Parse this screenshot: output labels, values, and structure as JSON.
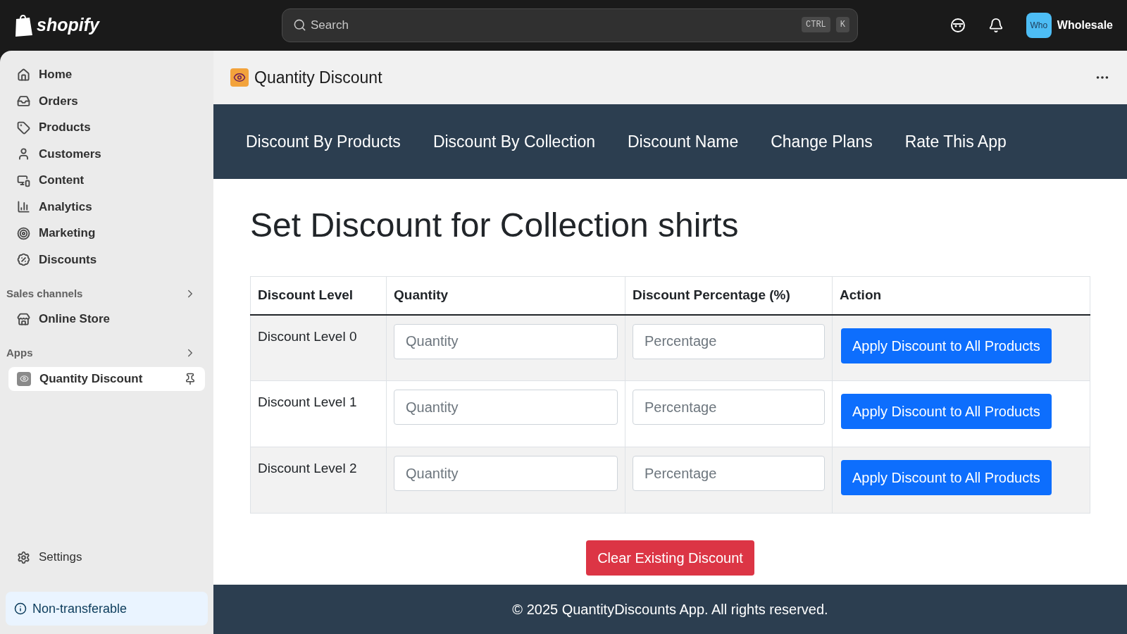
{
  "topbar": {
    "brand": "shopify",
    "search": {
      "placeholder": "Search",
      "shortcut": [
        "CTRL",
        "K"
      ]
    },
    "avatar": "Who",
    "store_name": "Wholesale"
  },
  "sidebar": {
    "items": [
      {
        "label": "Home",
        "selected": false
      },
      {
        "label": "Orders",
        "selected": false
      },
      {
        "label": "Products",
        "selected": false
      },
      {
        "label": "Customers",
        "selected": false
      },
      {
        "label": "Content",
        "selected": false
      },
      {
        "label": "Analytics",
        "selected": false
      },
      {
        "label": "Marketing",
        "selected": false
      },
      {
        "label": "Discounts",
        "selected": false
      }
    ],
    "sections": [
      {
        "title": "Sales channels",
        "items": [
          {
            "label": "Online Store",
            "selected": false,
            "pinned": false
          }
        ]
      },
      {
        "title": "Apps",
        "items": [
          {
            "label": "Quantity Discount",
            "selected": true,
            "pinned": true
          }
        ]
      }
    ],
    "settings": "Settings",
    "notice": "Non-transferable"
  },
  "app": {
    "title": "Quantity Discount",
    "nav": [
      {
        "label": "Discount By Products"
      },
      {
        "label": "Discount By Collection"
      },
      {
        "label": "Discount Name"
      },
      {
        "label": "Change Plans"
      },
      {
        "label": "Rate This App"
      }
    ],
    "heading": "Set Discount for Collection shirts",
    "table": {
      "columns": [
        "Discount Level",
        "Quantity",
        "Discount Percentage (%)",
        "Action"
      ],
      "rows": [
        {
          "level": "Discount Level 0",
          "quantity_placeholder": "Quantity",
          "percentage_placeholder": "Percentage",
          "action": "Apply Discount to All Products"
        },
        {
          "level": "Discount Level 1",
          "quantity_placeholder": "Quantity",
          "percentage_placeholder": "Percentage",
          "action": "Apply Discount to All Products"
        },
        {
          "level": "Discount Level 2",
          "quantity_placeholder": "Quantity",
          "percentage_placeholder": "Percentage",
          "action": "Apply Discount to All Products"
        }
      ]
    },
    "clear_button": "Clear Existing Discount",
    "footer": "© 2025 QuantityDiscounts App. All rights reserved."
  }
}
